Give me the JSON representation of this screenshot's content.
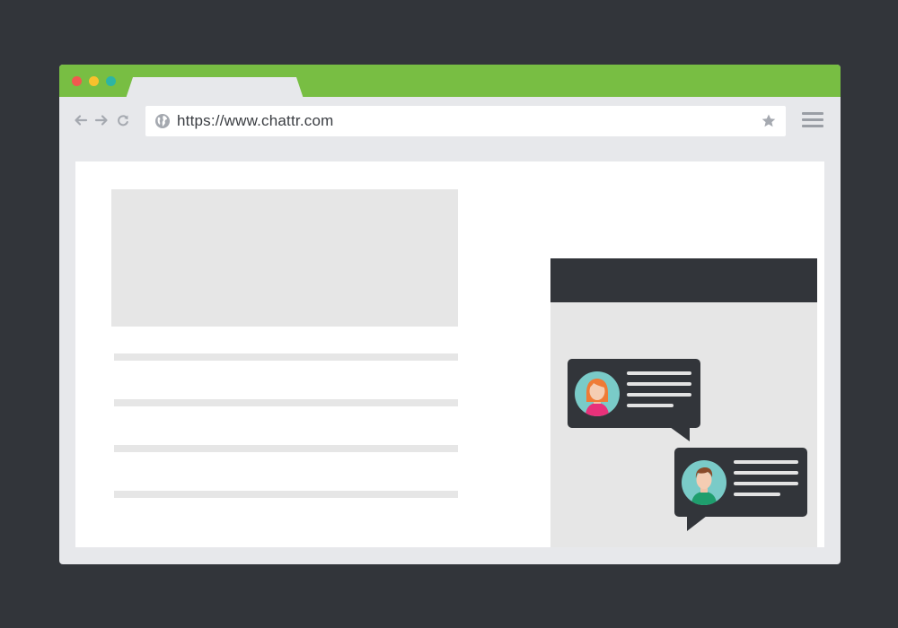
{
  "browser": {
    "url": "https://www.chattr.com",
    "titlebar_color": "#78be43",
    "window_dots": [
      "#f0594f",
      "#f8c12d",
      "#2db5a4"
    ],
    "toolbar_icons": [
      "back-arrow-icon",
      "forward-arrow-icon",
      "reload-icon",
      "globe-icon",
      "bookmark-star-icon",
      "hamburger-menu-icon"
    ]
  },
  "chat_widget": {
    "messages": [
      {
        "sender": "woman-avatar"
      },
      {
        "sender": "man-avatar"
      }
    ]
  }
}
